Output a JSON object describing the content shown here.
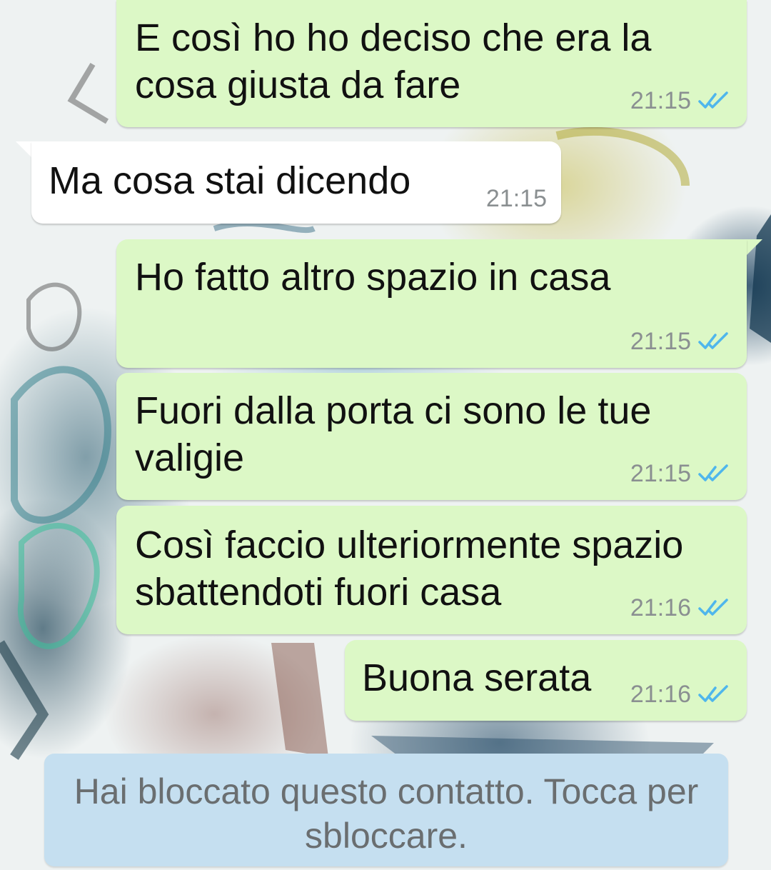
{
  "messages": [
    {
      "direction": "outgoing",
      "text": "E così ho ho deciso che era la\ncosa giusta da fare",
      "time": "21:15",
      "status_icon": "double-check-read-icon"
    },
    {
      "direction": "incoming",
      "text": "Ma cosa stai dicendo",
      "time": "21:15"
    },
    {
      "direction": "outgoing",
      "text": "Ho fatto altro spazio in casa",
      "time": "21:15",
      "status_icon": "double-check-read-icon"
    },
    {
      "direction": "outgoing",
      "text": "Fuori dalla porta ci sono le tue\nvaligie",
      "time": "21:15",
      "status_icon": "double-check-read-icon"
    },
    {
      "direction": "outgoing",
      "text": "Così faccio ulteriormente spazio\nsbattendoti fuori casa",
      "time": "21:16",
      "status_icon": "double-check-read-icon"
    },
    {
      "direction": "outgoing",
      "text": "Buona serata",
      "time": "21:16",
      "status_icon": "double-check-read-icon"
    }
  ],
  "blocked_banner": {
    "text": "Hai bloccato questo contatto. Tocca per sbloccare."
  },
  "colors": {
    "outgoing_bubble": "#dcf8c6",
    "incoming_bubble": "#ffffff",
    "read_ticks": "#4fb6ec",
    "banner": "#c5dff0",
    "timestamp": "#8a8f91"
  }
}
